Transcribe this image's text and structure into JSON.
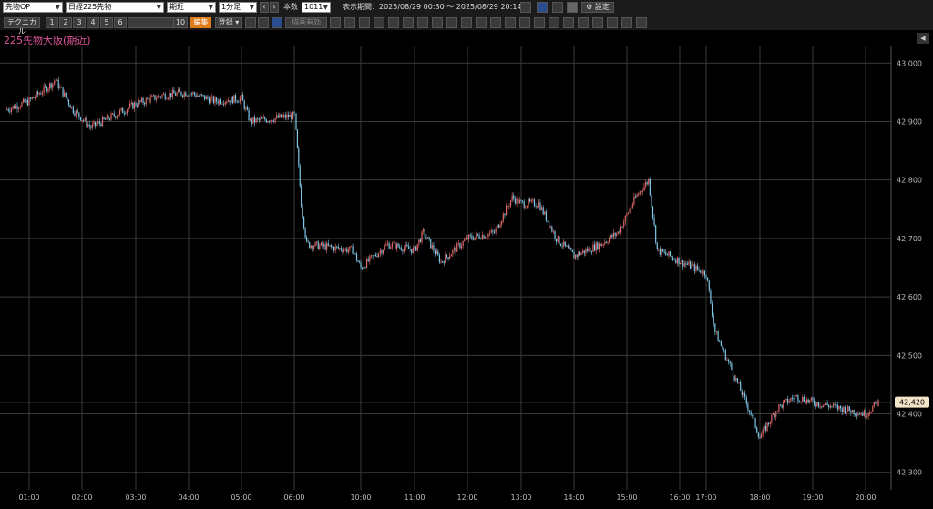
{
  "toolbar1": {
    "market_select": "先物OP",
    "symbol_select": "日経225先物",
    "contract_select": "期近",
    "interval_select": "1分足",
    "count_label": "本数",
    "count_value": "1011",
    "period_label": "表示期間：",
    "period_value": "2025/08/29 00:30 〜 2025/08/29 20:14",
    "settings_label": "設定"
  },
  "toolbar2": {
    "technical_label": "テクニカル",
    "tabs": [
      "1",
      "2",
      "3",
      "4",
      "5",
      "6",
      "10"
    ],
    "edit_label": "編集",
    "register_label": "登録",
    "trend_select": "描画有効"
  },
  "chart_title": "225先物大阪(期近)",
  "colors": {
    "up": "#e26a6a",
    "down": "#7ec8e8",
    "grid": "#3a3a3a",
    "title": "#e0559a",
    "current_price_tag": "#f3e6c8"
  },
  "chart_data": {
    "type": "candlestick",
    "title": "225先物大阪(期近)",
    "interval": "1分足",
    "ylim": [
      42270,
      43030
    ],
    "yticks": [
      42300,
      42400,
      42500,
      42600,
      42700,
      42800,
      42900,
      43000
    ],
    "ytick_labels": [
      "42,300",
      "42,400",
      "42,500",
      "42,600",
      "42,700",
      "42,800",
      "42,900",
      "43,000"
    ],
    "xtick_labels": [
      "01:00",
      "02:00",
      "03:00",
      "04:00",
      "05:00",
      "06:00",
      "10:00",
      "11:00",
      "12:00",
      "13:00",
      "14:00",
      "15:00",
      "16:00",
      "17:00",
      "18:00",
      "19:00",
      "20:00"
    ],
    "current_price": 42420,
    "current_price_label": "42,420",
    "grid": true,
    "approx_close_path": [
      {
        "t": "00:30",
        "v": 42920
      },
      {
        "t": "01:00",
        "v": 42935
      },
      {
        "t": "01:30",
        "v": 42970
      },
      {
        "t": "01:50",
        "v": 42920
      },
      {
        "t": "02:10",
        "v": 42890
      },
      {
        "t": "03:00",
        "v": 42930
      },
      {
        "t": "03:30",
        "v": 42945
      },
      {
        "t": "04:00",
        "v": 42950
      },
      {
        "t": "04:30",
        "v": 42935
      },
      {
        "t": "05:00",
        "v": 42940
      },
      {
        "t": "05:10",
        "v": 42900
      },
      {
        "t": "06:00",
        "v": 42910
      },
      {
        "t": "06:01",
        "v": 42880
      },
      {
        "t": "06:20",
        "v": 42760
      },
      {
        "t": "06:40",
        "v": 42690
      },
      {
        "t": "09:30",
        "v": 42680
      },
      {
        "t": "10:00",
        "v": 42650
      },
      {
        "t": "10:30",
        "v": 42690
      },
      {
        "t": "11:00",
        "v": 42680
      },
      {
        "t": "11:10",
        "v": 42710
      },
      {
        "t": "11:30",
        "v": 42660
      },
      {
        "t": "12:00",
        "v": 42700
      },
      {
        "t": "12:30",
        "v": 42710
      },
      {
        "t": "12:50",
        "v": 42770
      },
      {
        "t": "13:00",
        "v": 42760
      },
      {
        "t": "13:20",
        "v": 42760
      },
      {
        "t": "13:40",
        "v": 42700
      },
      {
        "t": "14:00",
        "v": 42670
      },
      {
        "t": "14:30",
        "v": 42690
      },
      {
        "t": "14:50",
        "v": 42710
      },
      {
        "t": "15:10",
        "v": 42770
      },
      {
        "t": "15:25",
        "v": 42800
      },
      {
        "t": "15:35",
        "v": 42680
      },
      {
        "t": "17:00",
        "v": 42640
      },
      {
        "t": "17:10",
        "v": 42540
      },
      {
        "t": "17:30",
        "v": 42470
      },
      {
        "t": "17:50",
        "v": 42400
      },
      {
        "t": "18:00",
        "v": 42360
      },
      {
        "t": "18:20",
        "v": 42410
      },
      {
        "t": "18:40",
        "v": 42430
      },
      {
        "t": "19:00",
        "v": 42420
      },
      {
        "t": "19:30",
        "v": 42410
      },
      {
        "t": "20:00",
        "v": 42400
      },
      {
        "t": "20:14",
        "v": 42420
      }
    ]
  }
}
